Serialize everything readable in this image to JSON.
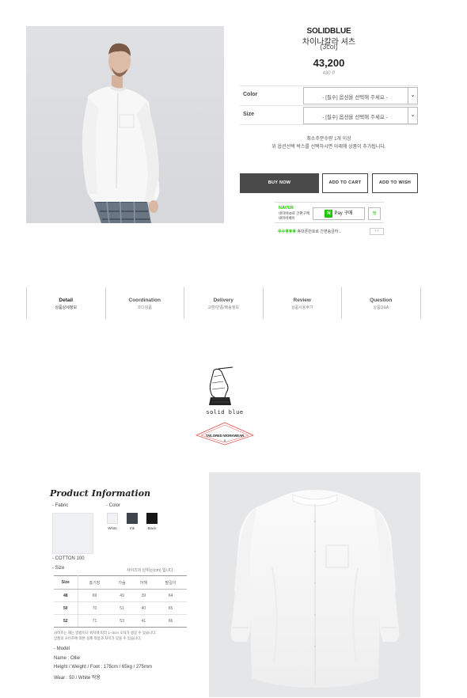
{
  "product": {
    "brand": "SOLIDBLUE",
    "name": "차이나칼라 셔츠",
    "variant": "(3col)",
    "price": "43,200",
    "points": "430 P"
  },
  "options": [
    {
      "label": "Color",
      "value": "- [필수] 옵션을 선택해 주세요 -"
    },
    {
      "label": "Size",
      "value": "- [필수] 옵션을 선택해 주세요 -"
    }
  ],
  "notice": {
    "line1": "최소주문수량 1개 이상",
    "line2": "위 옵션선택 박스를 선택하시면 아래에 상품이 추가됩니다."
  },
  "buttons": {
    "buy": "BUY NOW",
    "cart": "ADD TO CART",
    "wish": "ADD TO WISH"
  },
  "naver": {
    "logo": "NAVER",
    "sub1": "네이버ID로 간편구매",
    "sub2": "네이버페이",
    "pay": "Pay 구매",
    "pay_n": "N",
    "zzim": "찜",
    "event_green": "우수후후후",
    "event_text": "휴대폰번호로 간편송금하...",
    "arrows": "‹ ›"
  },
  "tabs": [
    {
      "title": "Detail",
      "sub": "상품상세정보"
    },
    {
      "title": "Coordination",
      "sub": "코디상품"
    },
    {
      "title": "Delivery",
      "sub": "교환/반품/배송정보"
    },
    {
      "title": "Review",
      "sub": "상품사용후기"
    },
    {
      "title": "Question",
      "sub": "상품Q&A"
    }
  ],
  "brand_logo": {
    "text": "solid blue",
    "badge": "TAILORED WORKWEAR",
    "badge_mark": "&"
  },
  "info": {
    "title": "Product Information",
    "fabric_label": "- Fabric",
    "fabric_value": "- COTTON 100",
    "color_label": "- Color",
    "colors": [
      {
        "name": "White",
        "hex": "#f1f2f5"
      },
      {
        "name": "Ink",
        "hex": "#3e444c"
      },
      {
        "name": "Black",
        "hex": "#161616"
      }
    ],
    "size_label": "- Size",
    "size_note": "사이즈의 단위는(cm) 입니다.",
    "size_headers": [
      "Size",
      "총기장",
      "가슴",
      "어깨",
      "팔길이"
    ],
    "size_rows": [
      [
        "48",
        "69",
        "49",
        "39",
        "64"
      ],
      [
        "50",
        "70",
        "51",
        "40",
        "65"
      ],
      [
        "52",
        "71",
        "53",
        "41",
        "66"
      ]
    ],
    "fine1": "사이즈는 재는 방법이나 위치에 따라 1~3cm 오차가 생길 수 있습니다.",
    "fine2": "상품의 사이즈에 따른 실제 착용과 차이가 있을 수 있습니다.",
    "model_label": "- Model",
    "model_name": "Name : Ollie",
    "model_body": "Height / Weight / Foot : 175cm / 65kg / 275mm",
    "model_wear": "Wear : 50 / White 착용"
  }
}
